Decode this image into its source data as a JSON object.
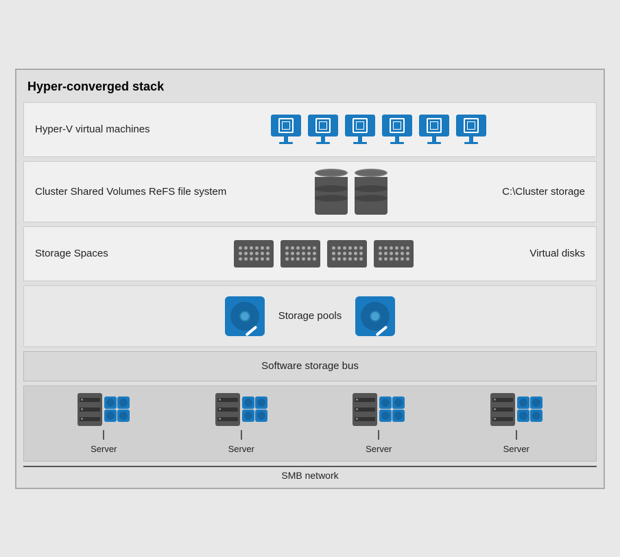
{
  "title": "Hyper-converged stack",
  "layers": {
    "hyperv": {
      "label": "Hyper-V virtual machines",
      "vm_count": 6
    },
    "csv": {
      "label": "Cluster Shared Volumes ReFS file system",
      "right_label": "C:\\Cluster storage",
      "db_count": 2
    },
    "storage_spaces": {
      "label": "Storage Spaces",
      "right_label": "Virtual disks",
      "raid_count": 4
    },
    "storage_pools": {
      "label": "Storage pools",
      "hdd_count": 2
    },
    "software_bus": {
      "label": "Software storage bus"
    },
    "servers": {
      "items": [
        {
          "label": "Server"
        },
        {
          "label": "Server"
        },
        {
          "label": "Server"
        },
        {
          "label": "Server"
        }
      ]
    },
    "smb": {
      "label": "SMB network"
    }
  }
}
